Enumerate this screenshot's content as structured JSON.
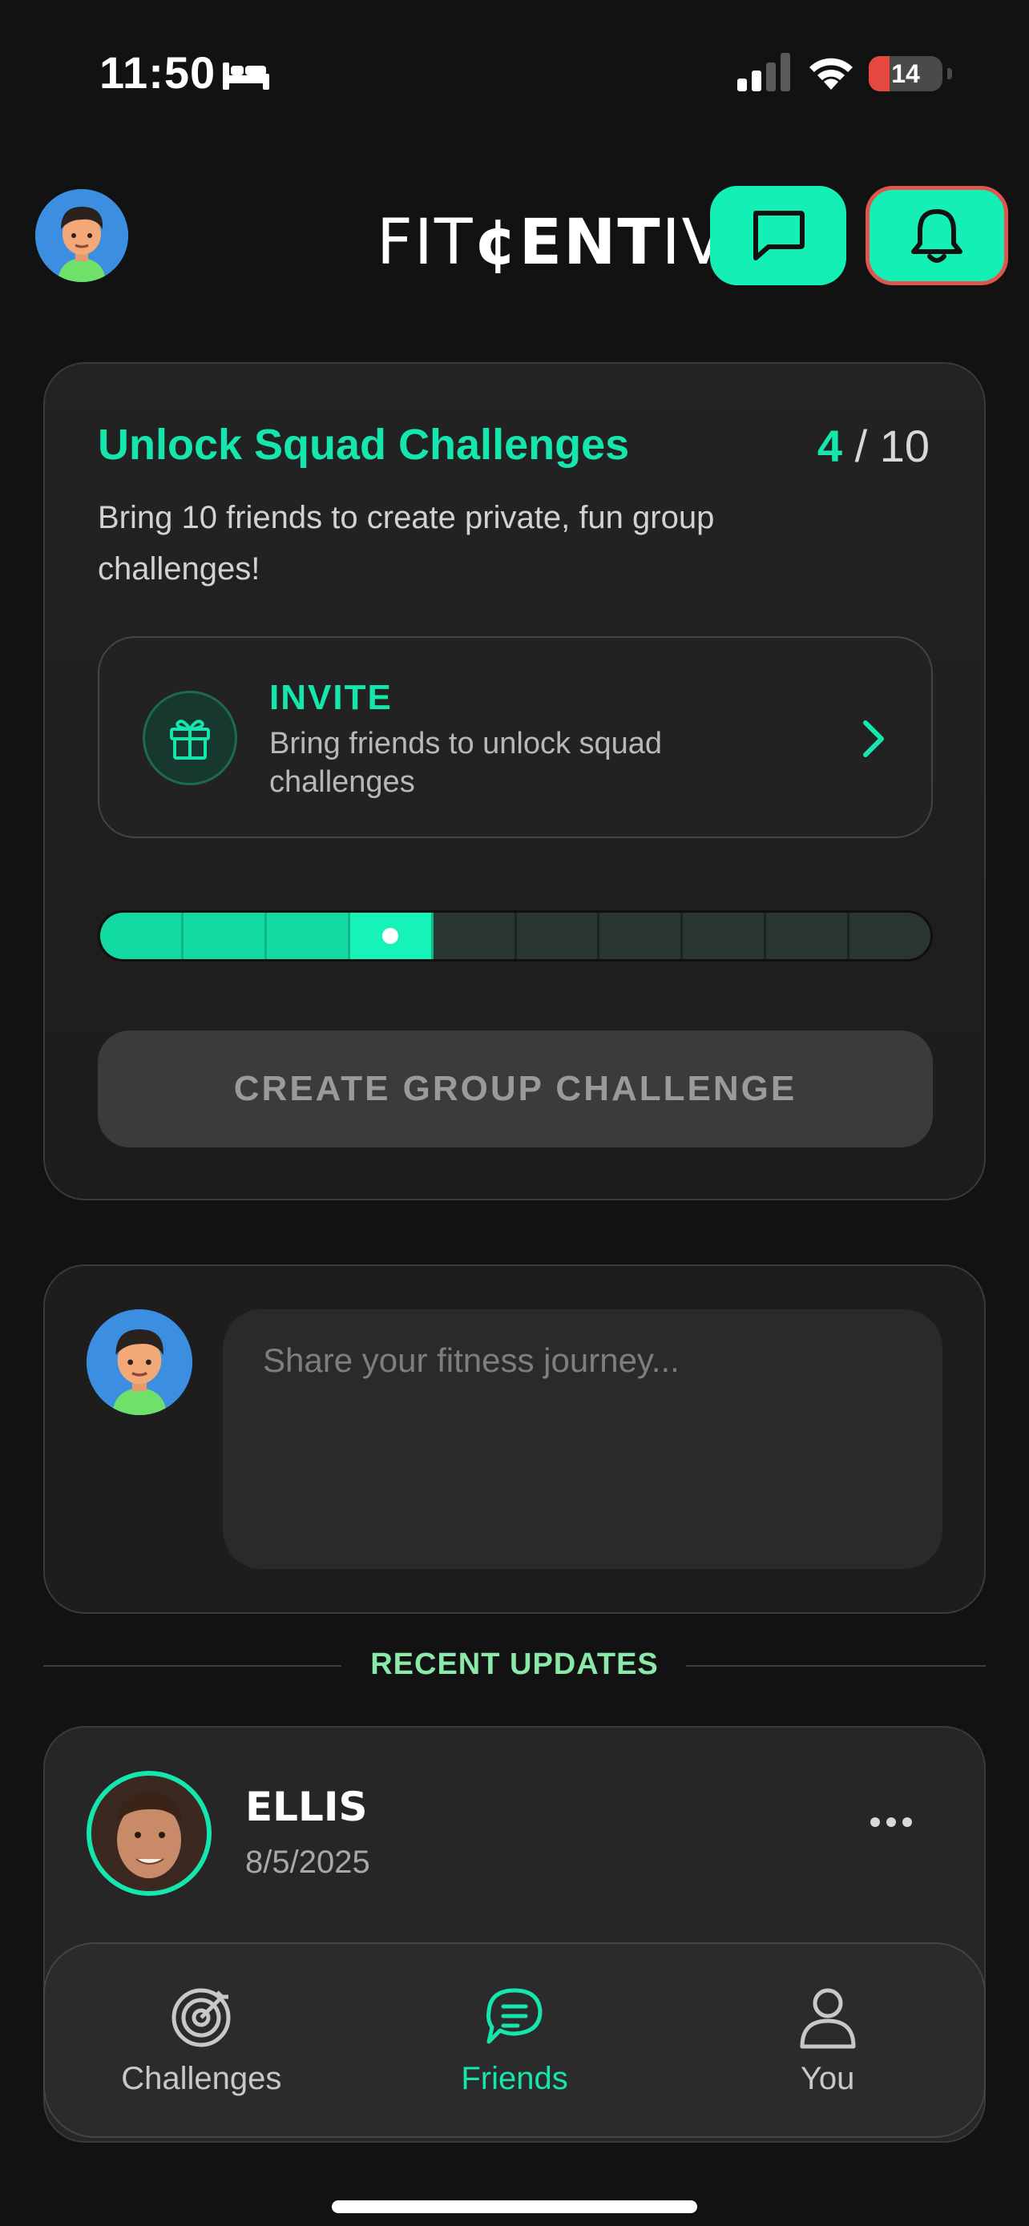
{
  "status_bar": {
    "time": "11:50",
    "battery_level": "14"
  },
  "header": {
    "logo_part1": "FIT",
    "logo_part2": "¢ENT",
    "logo_part3": "IVE",
    "chat_icon": "chat-bubble-icon",
    "bell_icon": "bell-icon"
  },
  "unlock_card": {
    "title": "Unlock Squad Challenges",
    "count_current": "4",
    "count_sep": " / ",
    "count_total": "10",
    "description": "Bring 10 friends to create private, fun group challenges!",
    "invite": {
      "label": "INVITE",
      "subtitle": "Bring friends to unlock squad challenges"
    },
    "progress": {
      "filled": 4,
      "total": 10
    },
    "create_button": "CREATE GROUP CHALLENGE"
  },
  "composer": {
    "placeholder": "Share your fitness journey..."
  },
  "recent_updates_label": "RECENT UPDATES",
  "post": {
    "name": "ELLIS",
    "date": "8/5/2025"
  },
  "tabs": [
    {
      "label": "Challenges",
      "icon": "target-icon",
      "active": false
    },
    {
      "label": "Friends",
      "icon": "chat-group-icon",
      "active": true
    },
    {
      "label": "You",
      "icon": "person-icon",
      "active": false
    }
  ],
  "colors": {
    "accent": "#14e6ae",
    "alert": "#e0554e",
    "background": "#121212"
  }
}
